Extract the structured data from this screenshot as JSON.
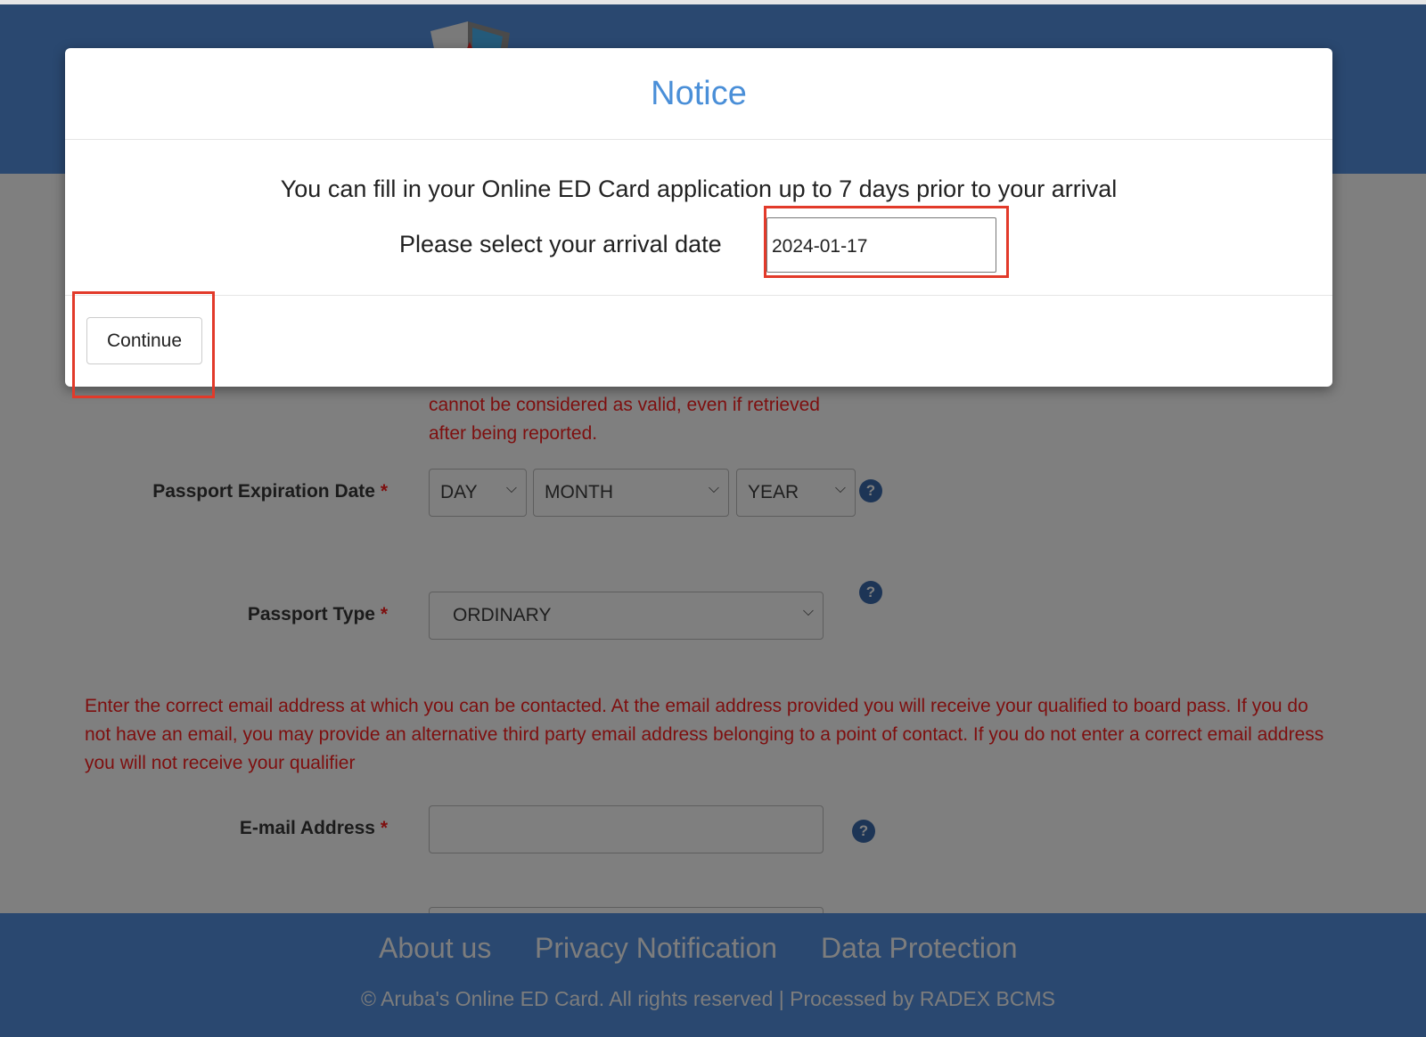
{
  "page": {
    "warning_lines": [
      "cannot be considered as valid, even if retrieved",
      "after being reported."
    ],
    "passport_expiration": {
      "label": "Passport Expiration Date",
      "required": "*",
      "day": "DAY",
      "month": "MONTH",
      "year": "YEAR"
    },
    "passport_type": {
      "label": "Passport Type",
      "required": "*",
      "value": "ORDINARY"
    },
    "email_notice": [
      "Enter the correct email address at which you can be contacted. At the email address provided you will receive your qualified to board pass. If you do",
      "not have an email, you may provide an alternative third party email address belonging to a point of contact. If you do not enter a correct email address",
      "you will not receive your qualifier"
    ],
    "email": {
      "label": "E-mail Address",
      "required": "*",
      "value": ""
    },
    "help_icon": "?"
  },
  "footer": {
    "links": [
      "About us",
      "Privacy Notification",
      "Data Protection"
    ],
    "copyright": "©  Aruba's Online ED Card. All rights reserved | Processed by RADEX BCMS"
  },
  "modal": {
    "title": "Notice",
    "message": "You can fill in your Online ED Card application up to 7 days prior to your arrival",
    "date_label": "Please select your arrival date",
    "date_value": "2024-01-17",
    "continue_label": "Continue"
  },
  "colors": {
    "accent": "#4a8fd8",
    "highlight": "#e23a2a",
    "header": "#2a4870"
  }
}
